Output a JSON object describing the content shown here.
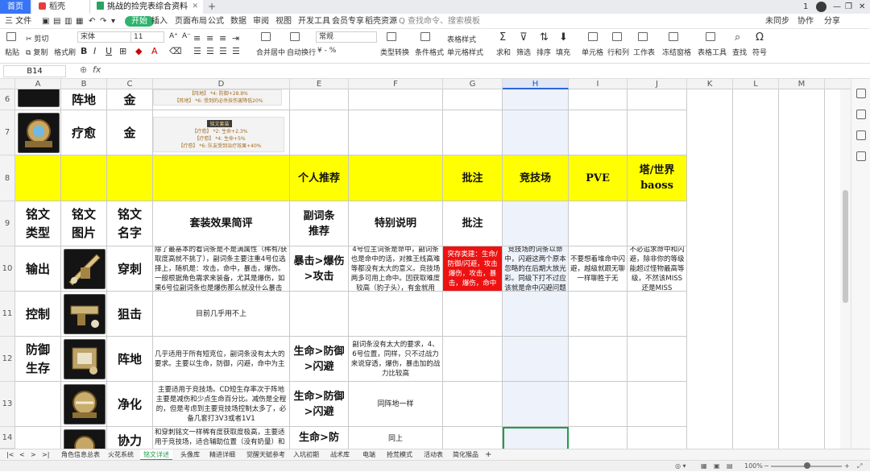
{
  "window": {
    "tabs": [
      {
        "label": "首页"
      },
      {
        "label": "稻壳"
      },
      {
        "label": "挑战的捡完表综合资料6.4.xlsx"
      }
    ],
    "new_tab": "+",
    "right_count": "1"
  },
  "menu": {
    "file": "三 文件",
    "items": [
      "开始",
      "插入",
      "页面布局",
      "公式",
      "数据",
      "审阅",
      "视图",
      "开发工具",
      "会员专享",
      "稻壳资源"
    ],
    "search_placeholder": "Q 查找命令、搜索模板",
    "unsynced": "未同步",
    "collab": "协作",
    "share": "分享"
  },
  "ribbon": {
    "paste": "粘贴",
    "cut": "剪切",
    "copy": "复制",
    "format_painter": "格式刷",
    "font_name": "宋体",
    "font_size": "11",
    "font_grow": "A⁺",
    "font_shrink": "A⁻",
    "bold": "B",
    "italic": "I",
    "underline": "U",
    "merge": "合并居中",
    "wrap": "自动换行",
    "number_format": "常规",
    "currency": "¥ - %",
    "convert": "类型转换",
    "cond_format": "条件格式",
    "table_style": "表格样式",
    "cell_style": "单元格样式",
    "sum": "求和",
    "filter": "筛选",
    "sort": "排序",
    "fill": "填充",
    "cell": "单元格",
    "row_col": "行和列",
    "worksheet": "工作表",
    "freeze": "冻结窗格",
    "table_tools": "表格工具",
    "find": "查找",
    "symbol": "符号"
  },
  "formula": {
    "name_box": "B14",
    "fx": "fx",
    "zoom_icon": "⊕"
  },
  "columns": [
    "A",
    "B",
    "C",
    "D",
    "E",
    "F",
    "G",
    "H",
    "I",
    "J",
    "K",
    "L",
    "M"
  ],
  "rows": {
    "r6": {
      "num": "6",
      "b": "阵地",
      "c": "金",
      "tooltip": [
        "【阵地】 *4: 防御+28.8%",
        "【阵地】 *6: 受到的必杀技伤害降低20%"
      ]
    },
    "r7": {
      "num": "7",
      "b": "疗愈",
      "c": "金",
      "tooltip_title": "铭文套装",
      "tooltip": [
        "【疗愈】 *2: 生命+2.3%",
        "【疗愈】 *4: 生命+5%",
        "【疗愈】 *6: 队友受到治疗效果+40%"
      ]
    },
    "r8": {
      "num": "8",
      "e": "个人推荐",
      "g": "批注",
      "h": "竞技场",
      "i": "PVE",
      "j": "塔/世界baoss"
    },
    "r9": {
      "num": "9",
      "a": "铭文类型",
      "b": "铭文图片",
      "c": "铭文名字",
      "d": "套装效果简评",
      "e": "副词条推荐",
      "f": "特别说明",
      "g": "批注"
    },
    "r10": {
      "num": "10",
      "a": "输出",
      "c": "穿刺",
      "d": "除了最基本的看词条是不是满属性（稀有/获取度高就不挑了），副词条主要注重4号位选择上，随机是：攻击，命中，暴击，爆伤。一般根据角色需求来装备，尤其是爆伤，如果6号位副词条也是爆伤那么就没什么暴击",
      "e": "暴击>爆伤>攻击",
      "f": "4号位主词条是命中，副词条也是命中的话，对推王线高难等都没有太大的意义。竞技场两多可用上命中。因获取难度较高（豹子头），有金就用",
      "g": "突存类建：生命/防御/闪避，攻击爆伤，攻击，暴击，爆伤，命中",
      "h": "竞技场的词条以命中，闪避这两个原本忽略的在后期大放光彩。同级下打不过应该就是命中闪避问题",
      "i": "不要想着堆命中闪避，越级就跟无聊一样聊胜于无",
      "j": "不必追求命中和闪避，除非你的等级能超过怪物最高等级，不然该MISS还是MISS"
    },
    "r11": {
      "num": "11",
      "a": "控制",
      "c": "狙击",
      "d": "目前几乎用不上"
    },
    "r12": {
      "num": "12",
      "a": "防御生存",
      "c": "阵地",
      "d": "几乎适用于所有短克位，副词条没有太大的要求。主要以生命，防御，闪避，命中为主",
      "e": "生命>防御>闪避",
      "f": "副词条没有太大的要求，4、6号位置，同样，只不过战力来说穿透，爆伤，暴击加的战力比较高"
    },
    "r13": {
      "num": "13",
      "c": "净化",
      "d": "主要适用于竞技场。CD短生存率次于阵地主要是减伤和少点生命百分比。减伤是全程的，但是考虑到主要竞技场控制太多了，必备几套打3V3或者1V1",
      "e": "生命>防御>闪避",
      "f": "同阵地一样"
    },
    "r14": {
      "num": "14",
      "c": "协力",
      "d": "和穿刺铭文一样稀有度获取度极高，主要适用于竞技场，适合辅助位置（没有奶量）和",
      "e": "生命>防",
      "f": "同上"
    }
  },
  "sheets": [
    "角色信息总表",
    "火花系统",
    "铭文详述",
    "头像库",
    "精进详细",
    "觉醒天赋参考",
    "入坑初期",
    "战术库",
    "电端",
    "抢荒模式",
    "活动表",
    "简化猴品"
  ],
  "active_sheet": "铭文详述",
  "status": {
    "zoom": "100%",
    "minus": "−",
    "plus": "+"
  }
}
